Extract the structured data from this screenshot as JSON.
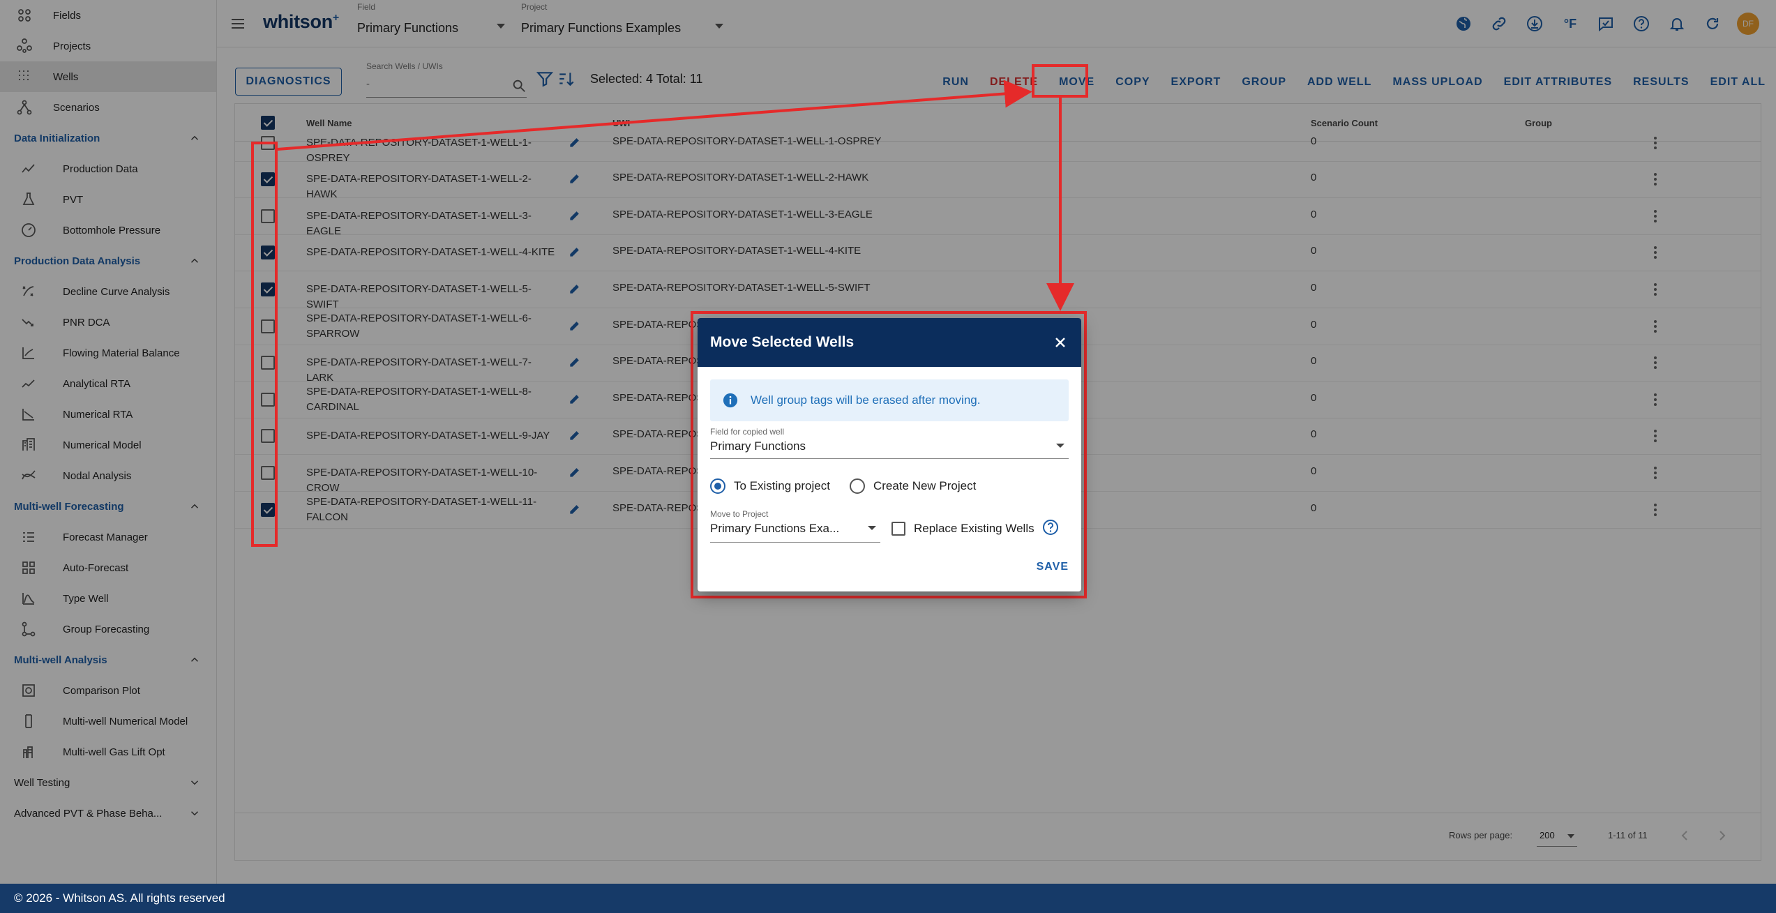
{
  "sidebar": {
    "top_items": [
      {
        "label": "Fields",
        "icon": "fields-icon"
      },
      {
        "label": "Projects",
        "icon": "projects-icon"
      },
      {
        "label": "Wells",
        "icon": "wells-icon",
        "active": true
      },
      {
        "label": "Scenarios",
        "icon": "scenarios-icon"
      }
    ],
    "sections": [
      {
        "label": "Data Initialization",
        "open": true,
        "items": [
          {
            "label": "Production Data",
            "icon": "production-data-icon"
          },
          {
            "label": "PVT",
            "icon": "pvt-icon"
          },
          {
            "label": "Bottomhole Pressure",
            "icon": "bottomhole-pressure-icon"
          }
        ]
      },
      {
        "label": "Production Data Analysis",
        "open": true,
        "items": [
          {
            "label": "Decline Curve Analysis",
            "icon": "decline-curve-icon"
          },
          {
            "label": "PNR DCA",
            "icon": "pnr-dca-icon"
          },
          {
            "label": "Flowing Material Balance",
            "icon": "flowing-material-balance-icon"
          },
          {
            "label": "Analytical RTA",
            "icon": "analytical-rta-icon"
          },
          {
            "label": "Numerical RTA",
            "icon": "numerical-rta-icon"
          },
          {
            "label": "Numerical Model",
            "icon": "numerical-model-icon"
          },
          {
            "label": "Nodal Analysis",
            "icon": "nodal-analysis-icon"
          }
        ]
      },
      {
        "label": "Multi-well Forecasting",
        "open": true,
        "items": [
          {
            "label": "Forecast Manager",
            "icon": "forecast-manager-icon"
          },
          {
            "label": "Auto-Forecast",
            "icon": "auto-forecast-icon"
          },
          {
            "label": "Type Well",
            "icon": "type-well-icon"
          },
          {
            "label": "Group Forecasting",
            "icon": "group-forecasting-icon"
          }
        ]
      },
      {
        "label": "Multi-well Analysis",
        "open": true,
        "items": [
          {
            "label": "Comparison Plot",
            "icon": "comparison-plot-icon"
          },
          {
            "label": "Multi-well Numerical Model",
            "icon": "multi-well-numerical-model-icon"
          },
          {
            "label": "Multi-well Gas Lift Opt",
            "icon": "multi-well-gas-lift-icon"
          }
        ]
      },
      {
        "label": "Well Testing",
        "open": false,
        "items": []
      },
      {
        "label": "Advanced PVT & Phase Beha...",
        "open": false,
        "items": []
      }
    ]
  },
  "header": {
    "logo": "whitson",
    "logo_sup": "+",
    "field_label": "Field",
    "field_value": "Primary Functions",
    "project_label": "Project",
    "project_value": "Primary Functions Examples",
    "units": "°F",
    "avatar_initials": "DF",
    "accent": "#1f5fa8"
  },
  "toolbar": {
    "diagnostics": "DIAGNOSTICS",
    "search_label": "Search Wells / UWIs",
    "search_placeholder": "-",
    "selection": "Selected: 4 Total: 11",
    "actions": [
      "RUN",
      "DELETE",
      "MOVE",
      "COPY",
      "EXPORT",
      "GROUP",
      "ADD WELL",
      "MASS UPLOAD",
      "EDIT ATTRIBUTES",
      "RESULTS",
      "EDIT ALL"
    ]
  },
  "table": {
    "columns": {
      "name": "Well Name",
      "uwi": "UWI",
      "scenario_count": "Scenario Count",
      "group": "Group"
    },
    "rows": [
      {
        "name": "SPE-DATA-REPOSITORY-DATASET-1-WELL-1-OSPREY",
        "uwi": "SPE-DATA-REPOSITORY-DATASET-1-WELL-1-OSPREY",
        "scenario_count": "0",
        "selected": false
      },
      {
        "name": "SPE-DATA-REPOSITORY-DATASET-1-WELL-2-HAWK",
        "uwi": "SPE-DATA-REPOSITORY-DATASET-1-WELL-2-HAWK",
        "scenario_count": "0",
        "selected": true
      },
      {
        "name": "SPE-DATA-REPOSITORY-DATASET-1-WELL-3-EAGLE",
        "uwi": "SPE-DATA-REPOSITORY-DATASET-1-WELL-3-EAGLE",
        "scenario_count": "0",
        "selected": false
      },
      {
        "name": "SPE-DATA-REPOSITORY-DATASET-1-WELL-4-KITE",
        "uwi": "SPE-DATA-REPOSITORY-DATASET-1-WELL-4-KITE",
        "scenario_count": "0",
        "selected": true
      },
      {
        "name": "SPE-DATA-REPOSITORY-DATASET-1-WELL-5-SWIFT",
        "uwi": "SPE-DATA-REPOSITORY-DATASET-1-WELL-5-SWIFT",
        "scenario_count": "0",
        "selected": true
      },
      {
        "name": "SPE-DATA-REPOSITORY-DATASET-1-WELL-6-SPARROW",
        "uwi": "SPE-DATA-REPOS",
        "scenario_count": "0",
        "selected": false
      },
      {
        "name": "SPE-DATA-REPOSITORY-DATASET-1-WELL-7-LARK",
        "uwi": "SPE-DATA-REPOS",
        "scenario_count": "0",
        "selected": false
      },
      {
        "name": "SPE-DATA-REPOSITORY-DATASET-1-WELL-8-CARDINAL",
        "uwi": "SPE-DATA-REPOS",
        "scenario_count": "0",
        "selected": false
      },
      {
        "name": "SPE-DATA-REPOSITORY-DATASET-1-WELL-9-JAY",
        "uwi": "SPE-DATA-REPOS",
        "scenario_count": "0",
        "selected": false
      },
      {
        "name": "SPE-DATA-REPOSITORY-DATASET-1-WELL-10-CROW",
        "uwi": "SPE-DATA-REPOS",
        "scenario_count": "0",
        "selected": false
      },
      {
        "name": "SPE-DATA-REPOSITORY-DATASET-1-WELL-11-FALCON",
        "uwi": "SPE-DATA-REPOS",
        "scenario_count": "0",
        "selected": true
      }
    ],
    "rows_per_page_label": "Rows per page:",
    "rows_per_page": "200",
    "page_info": "1-11 of 11"
  },
  "dialog": {
    "title": "Move Selected Wells",
    "alert": "Well group tags will be erased after moving.",
    "field_label": "Field for copied well",
    "field_value": "Primary Functions",
    "radio_existing": "To Existing project",
    "radio_new": "Create New Project",
    "project_label": "Move to Project",
    "project_value": "Primary Functions Exa...",
    "replace_label": "Replace Existing Wells",
    "save": "SAVE",
    "header_color": "#0b2d5c"
  },
  "footer": {
    "copyright": "© 2026 - Whitson AS. All rights reserved",
    "color": "#163a68"
  },
  "annotation_color": "#e52a2a"
}
